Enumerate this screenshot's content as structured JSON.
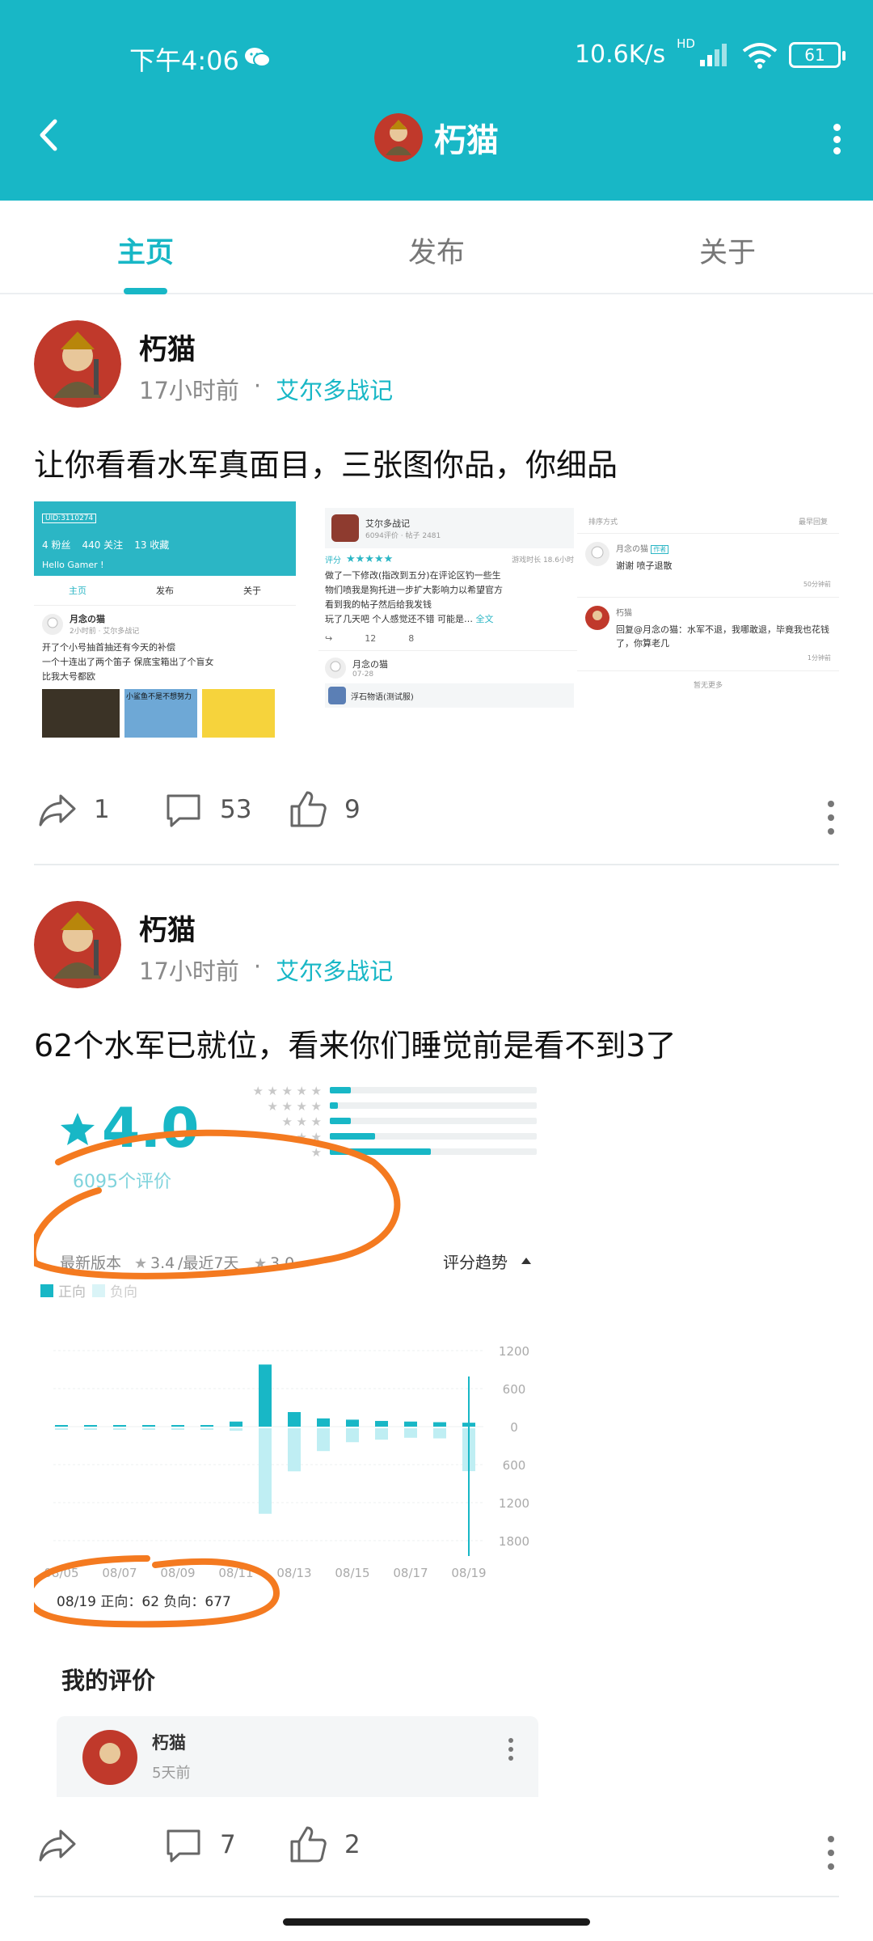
{
  "status_bar": {
    "time": "下午4:06",
    "network_speed": "10.6K/s",
    "hd": "HD",
    "battery": "61"
  },
  "header": {
    "title": "朽猫"
  },
  "tabs": [
    {
      "label": "主页",
      "active": true
    },
    {
      "label": "发布",
      "active": false
    },
    {
      "label": "关于",
      "active": false
    }
  ],
  "posts": [
    {
      "author": "朽猫",
      "time": "17小时前",
      "separator": "·",
      "game": "艾尔多战记",
      "text": "让你看看水军真面目，三张图你品，你细品",
      "shares": "1",
      "comments": "53",
      "likes": "9",
      "images": {
        "profile_thumb": {
          "id_badge": "UID:3110274",
          "fans": "4 粉丝",
          "follow": "440 关注",
          "fav": "13 收藏",
          "greeting": "Hello Gamer !",
          "tabs": [
            "主页",
            "发布",
            "关于"
          ],
          "user": "月念の猫",
          "time_game": "2小时前 · 艾尔多战记",
          "lines": [
            "开了个小号抽首抽还有今天的补偿",
            "一个十连出了两个笛子 保底宝箱出了个盲女",
            "比我大号都欧"
          ],
          "img_caption": "小鲨鱼不是不想努力"
        },
        "review_thumb": {
          "game": "艾尔多战记",
          "game_meta": "6094评价 · 帖子 2481",
          "score_label": "评分",
          "play_time": "游戏时长 18.6小时",
          "lines": [
            "做了一下修改(指改到五分)在评论区钓一些生",
            "物们喷我是狗托进一步扩大影响力以希望官方",
            "看到我的帖子然后给我发钱",
            "玩了几天吧 个人感觉还不错 可能是…"
          ],
          "full_link": "全文",
          "comments": "12",
          "likes": "8",
          "user2": "月念の猫",
          "date2": "07-28",
          "game2": "浮石物语(测试服)"
        },
        "comments_thumb": {
          "sort_label": "排序方式",
          "sort_value": "最早回复",
          "c1_user": "月念の猫",
          "c1_badge": "作者",
          "c1_text": "谢谢 喷子退散",
          "c1_time": "50分钟前",
          "c2_user": "朽猫",
          "c2_text": "回复@月念の猫：水军不退，我哪敢退，毕竟我也花钱了，你算老几",
          "c2_time": "1分钟前",
          "end_text": "暂无更多"
        }
      }
    },
    {
      "author": "朽猫",
      "time": "17小时前",
      "separator": "·",
      "game": "艾尔多战记",
      "text": "62个水军已就位，看来你们睡觉前是看不到3了",
      "shares": "",
      "comments": "7",
      "likes": "2",
      "screenshot": {
        "score": "4.0",
        "review_count": "6095个评价",
        "latest_version": "最新版本",
        "latest_score": "3.4",
        "recent_label": "/最近7天",
        "recent_score": "3.0",
        "trend_label": "评分趋势",
        "legend_pos": "正向",
        "legend_neg": "负向",
        "tooltip": "08/19 正向：62   负向：677",
        "my_review_title": "我的评价",
        "my_review_user": "朽猫",
        "my_review_time": "5天前"
      }
    }
  ],
  "chart_data": {
    "type": "bar",
    "categories": [
      "08/05",
      "08/06",
      "08/07",
      "08/08",
      "08/09",
      "08/10",
      "08/11",
      "08/12",
      "08/13",
      "08/14",
      "08/15",
      "08/16",
      "08/17",
      "08/18",
      "08/19"
    ],
    "x_tick_labels": [
      "08/05",
      "08/07",
      "08/09",
      "08/11",
      "08/13",
      "08/15",
      "08/17",
      "08/19"
    ],
    "y_tick_labels": [
      "1200",
      "600",
      "0",
      "600",
      "1200",
      "1800"
    ],
    "series": [
      {
        "name": "正向",
        "values": [
          3,
          5,
          8,
          10,
          18,
          25,
          80,
          980,
          230,
          130,
          110,
          90,
          80,
          70,
          62
        ]
      },
      {
        "name": "负向",
        "values": [
          2,
          3,
          5,
          6,
          10,
          15,
          40,
          1350,
          680,
          360,
          220,
          180,
          150,
          160,
          677
        ]
      }
    ],
    "ylim": [
      -1800,
      1200
    ],
    "rating_bars": [
      0.1,
      0.04,
      0.1,
      0.22,
      0.49
    ],
    "colors": {
      "positive": "#18b7c6",
      "negative": "#bfeef3",
      "annotation": "#f47a20"
    }
  }
}
